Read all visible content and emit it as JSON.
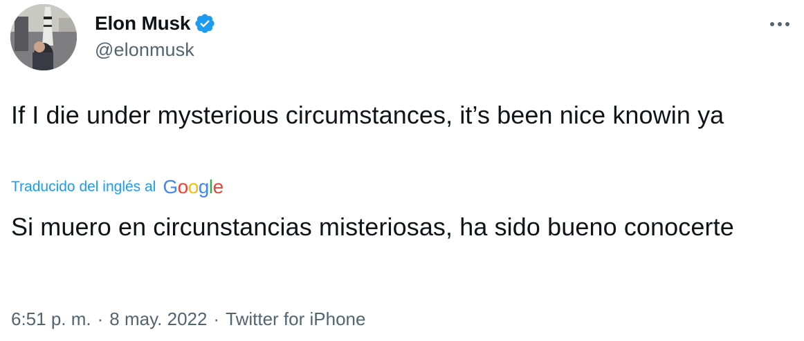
{
  "author": {
    "display_name": "Elon Musk",
    "handle": "@elonmusk"
  },
  "tweet": {
    "text": "If I die under mysterious circumstances, it’s been nice knowin ya",
    "translation_label": "Traducido del inglés al",
    "translation_provider_letters": [
      "G",
      "o",
      "o",
      "g",
      "l",
      "e"
    ],
    "translated_text": "Si muero en circunstancias misteriosas, ha sido bueno conocerte"
  },
  "meta": {
    "time": "6:51 p. m.",
    "separator": "·",
    "date": "8 may. 2022",
    "source": "Twitter for iPhone"
  },
  "colors": {
    "text_primary": "#0f1419",
    "text_secondary": "#536471",
    "link_blue": "#1d9bf0",
    "verified_blue": "#1d9bf0",
    "google_blue": "#4285f4",
    "google_red": "#ea4335",
    "google_yellow": "#fbbc05",
    "google_green": "#34a853"
  },
  "icons": {
    "verified": "verified-badge-icon",
    "more": "more-options-icon"
  }
}
